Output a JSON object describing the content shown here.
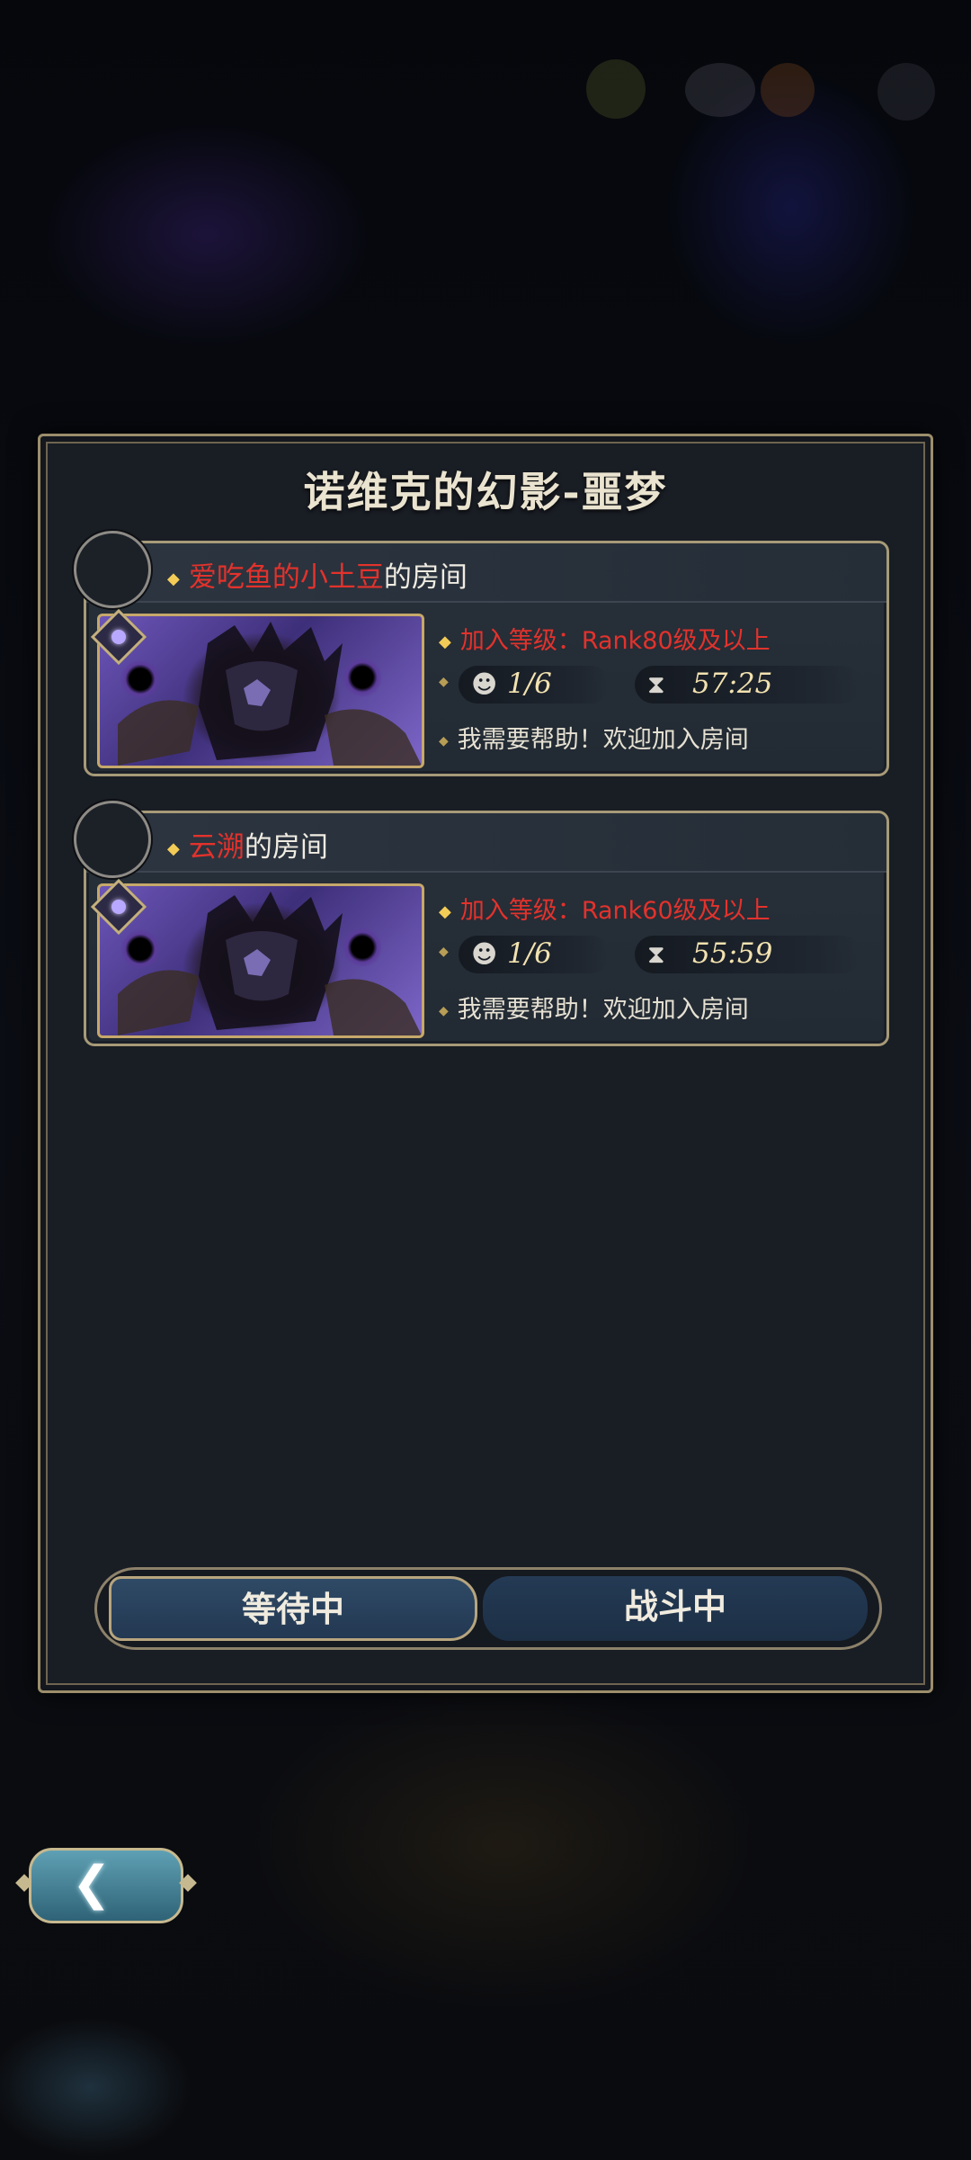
{
  "dialog": {
    "title": "诺维克的幻影-噩梦"
  },
  "rooms": [
    {
      "owner": "爱吃鱼的小土豆",
      "owner_suffix": "的房间",
      "requirement": "加入等级：Rank80级及以上",
      "players": "1/6",
      "time_left": "57:25",
      "message": "我需要帮助！欢迎加入房间",
      "player_icon": "player-count-icon",
      "time_icon": "hourglass-icon"
    },
    {
      "owner": "云溯",
      "owner_suffix": "的房间",
      "requirement": "加入等级：Rank60级及以上",
      "players": "1/6",
      "time_left": "55:59",
      "message": "我需要帮助！欢迎加入房间",
      "player_icon": "player-count-icon",
      "time_icon": "hourglass-icon"
    }
  ],
  "tabs": {
    "waiting": "等待中",
    "fighting": "战斗中",
    "active": "waiting"
  },
  "back_button": {
    "icon": "back-arrow-icon"
  },
  "colors": {
    "accent_red": "#e3322c",
    "gold_border": "#a79a78",
    "tab_active": "#2f4a66"
  }
}
